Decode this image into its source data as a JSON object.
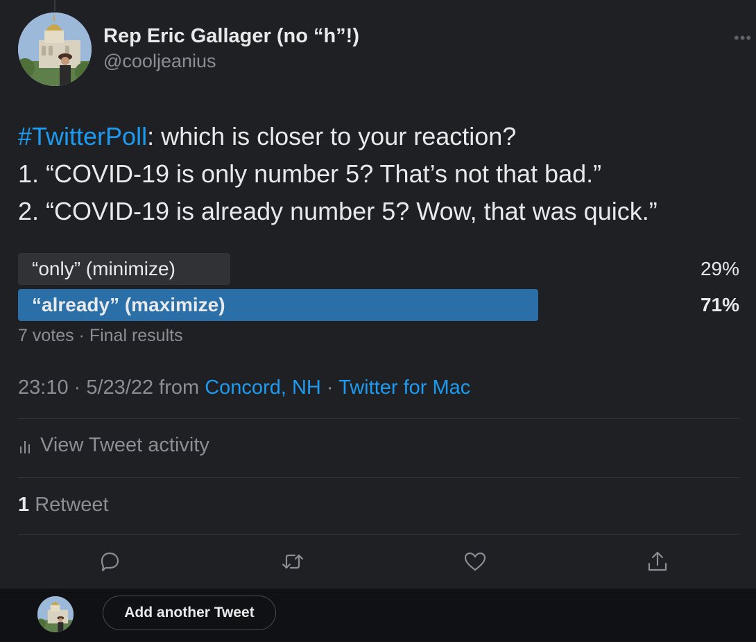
{
  "author": {
    "name": "Rep Eric Gallager (no “h”!)",
    "handle": "@cooljeanius"
  },
  "tweet": {
    "hashtag": "#TwitterPoll",
    "text_line1_rest": ": which is closer to your reaction?",
    "text_line2": "1. “COVID-19 is only number 5? That’s not that bad.”",
    "text_line3": "2. “COVID-19 is already number 5? Wow, that was quick.”"
  },
  "poll": {
    "options": [
      {
        "label": "“only” (minimize)",
        "percent_text": "29%",
        "percent": 29,
        "winner": false,
        "bar_color": "#303236"
      },
      {
        "label": "“already” (maximize)",
        "percent_text": "71%",
        "percent": 71,
        "winner": true,
        "bar_color": "#2b6fa9"
      }
    ],
    "meta": "7 votes · Final results"
  },
  "details": {
    "time": "23:10 · 5/23/22",
    "from_label": " from ",
    "location": "Concord, NH",
    "separator": " · ",
    "client": "Twitter for Mac"
  },
  "activity": {
    "label": "View Tweet activity",
    "icon": "bar-chart-icon"
  },
  "stats": {
    "retweet_count": "1",
    "retweet_label": " Retweet"
  },
  "actions": {
    "reply_icon": "reply-icon",
    "retweet_icon": "retweet-icon",
    "like_icon": "heart-icon",
    "share_icon": "share-icon"
  },
  "composer": {
    "add_button_label": "Add another Tweet"
  },
  "colors": {
    "background": "#1f2024",
    "accent": "#1d9bf0",
    "secondary_text": "#8b8f95",
    "composer_bar": "#101114"
  }
}
